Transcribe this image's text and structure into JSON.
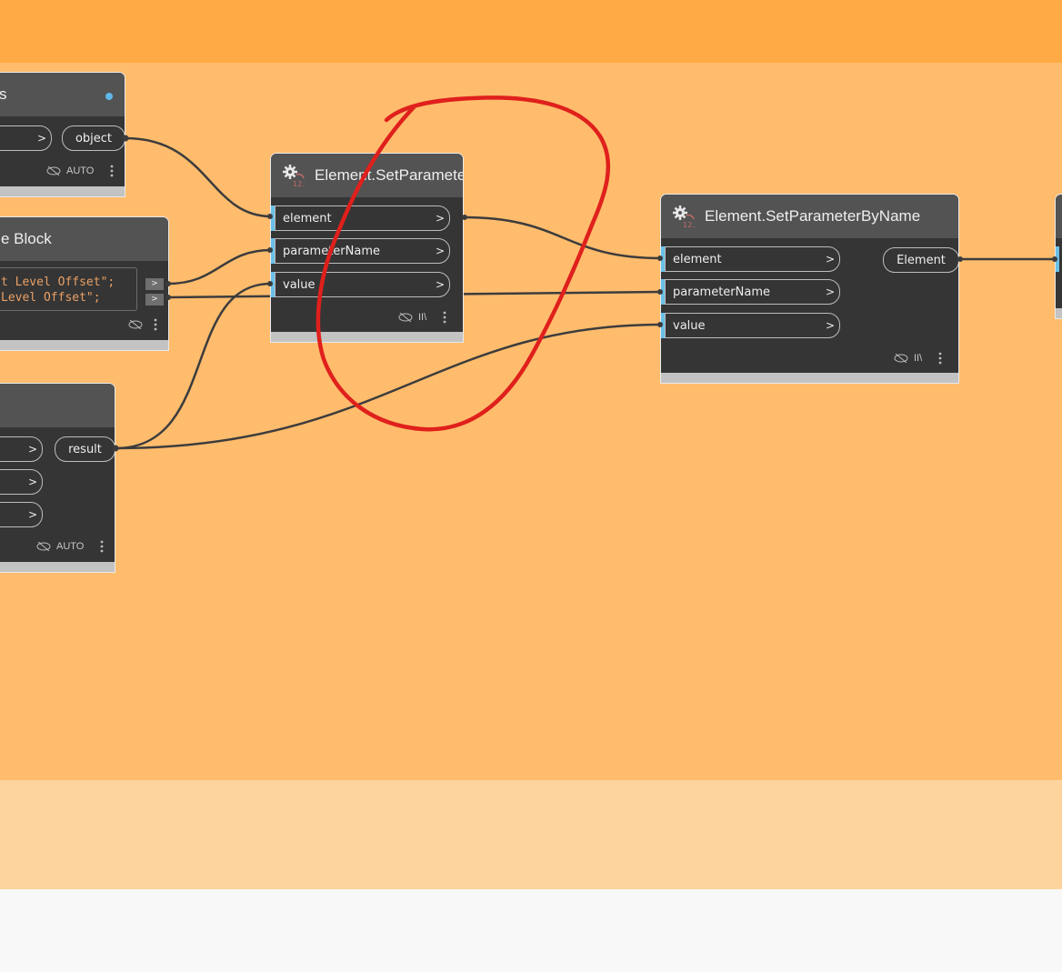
{
  "canvas": {
    "colors": {
      "band_top": "#ffaa45",
      "band_mid": "#ffbc6d",
      "band_low": "#fdd39e",
      "band_bottom": "#f8f8f8",
      "node_body": "#353535",
      "node_header": "#535353",
      "port_accent": "#6ac0e7",
      "annotation": "#e0201c",
      "code_text": "#e9a066"
    }
  },
  "nodes": {
    "left_top": {
      "title_fragment": "s",
      "input_chevron": ">",
      "output_label": "object",
      "footer_label": "AUTO",
      "icons": [
        "status-dot-icon",
        "eye-hidden-icon",
        "kebab-menu-icon"
      ]
    },
    "code_block": {
      "title_fragment": "e Block",
      "code_lines": [
        "t Level Offset\";",
        "Level Offset\";"
      ],
      "output_chevrons": [
        ">",
        ">"
      ],
      "icons": [
        "eye-hidden-icon",
        "kebab-menu-icon"
      ]
    },
    "left_bottom": {
      "input_chevrons": [
        ">",
        ">",
        ">"
      ],
      "output_label": "result",
      "footer_label": "AUTO",
      "icons": [
        "eye-hidden-icon",
        "kebab-menu-icon"
      ]
    },
    "set_param_1": {
      "title": "Element.SetParameterByName",
      "icon_caption": "12.3",
      "inputs": [
        {
          "label": "element",
          "chevron": ">"
        },
        {
          "label": "parameterName",
          "chevron": ">"
        },
        {
          "label": "value",
          "chevron": ">"
        }
      ],
      "footer_label": "II\\",
      "icons": [
        "gear-icon",
        "eye-hidden-icon",
        "kebab-menu-icon"
      ]
    },
    "set_param_2": {
      "title": "Element.SetParameterByName",
      "icon_caption": "12.3",
      "inputs": [
        {
          "label": "element",
          "chevron": ">"
        },
        {
          "label": "parameterName",
          "chevron": ">"
        },
        {
          "label": "value",
          "chevron": ">"
        }
      ],
      "output_label": "Element",
      "footer_label": "II\\",
      "icons": [
        "gear-icon",
        "eye-hidden-icon",
        "kebab-menu-icon"
      ]
    }
  }
}
